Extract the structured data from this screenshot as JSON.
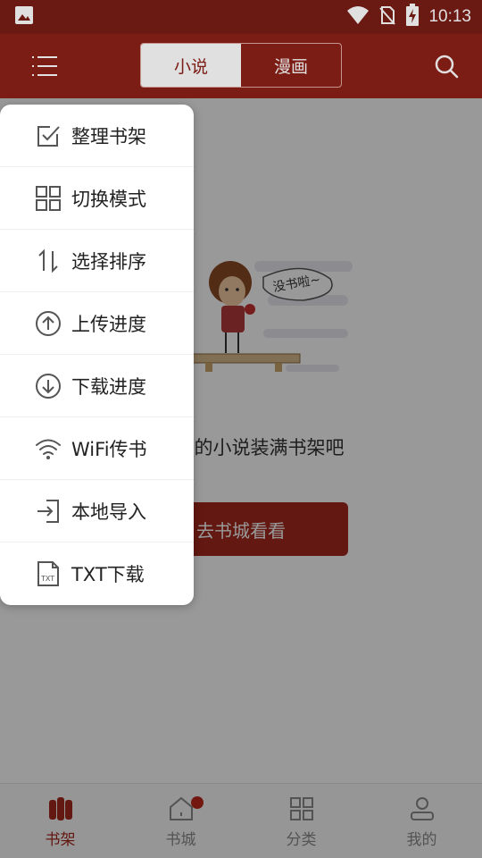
{
  "status_bar": {
    "time": "10:13"
  },
  "header": {
    "tabs": [
      {
        "label": "小说",
        "active": true
      },
      {
        "label": "漫画",
        "active": false
      }
    ]
  },
  "empty_state": {
    "message": "把喜欢的小说装满书架吧",
    "button_label": "去书城看看",
    "bubble_text": "没书啦~"
  },
  "popup_menu": {
    "items": [
      {
        "label": "整理书架",
        "icon": "edit-checkbox-icon"
      },
      {
        "label": "切换模式",
        "icon": "grid-icon"
      },
      {
        "label": "选择排序",
        "icon": "sort-arrows-icon"
      },
      {
        "label": "上传进度",
        "icon": "upload-circle-icon"
      },
      {
        "label": "下载进度",
        "icon": "download-circle-icon"
      },
      {
        "label": "WiFi传书",
        "icon": "wifi-icon"
      },
      {
        "label": "本地导入",
        "icon": "import-icon"
      },
      {
        "label": "TXT下载",
        "icon": "txt-file-icon"
      }
    ]
  },
  "bottom_nav": [
    {
      "label": "书架",
      "icon": "bookshelf-icon",
      "active": true
    },
    {
      "label": "书城",
      "icon": "home-icon",
      "active": false,
      "badge": true
    },
    {
      "label": "分类",
      "icon": "category-icon",
      "active": false
    },
    {
      "label": "我的",
      "icon": "user-icon",
      "active": false
    }
  ],
  "colors": {
    "header": "#8e2118",
    "status_bar": "#7a1d16",
    "accent": "#a5281d",
    "inactive": "#8a8a8a"
  }
}
